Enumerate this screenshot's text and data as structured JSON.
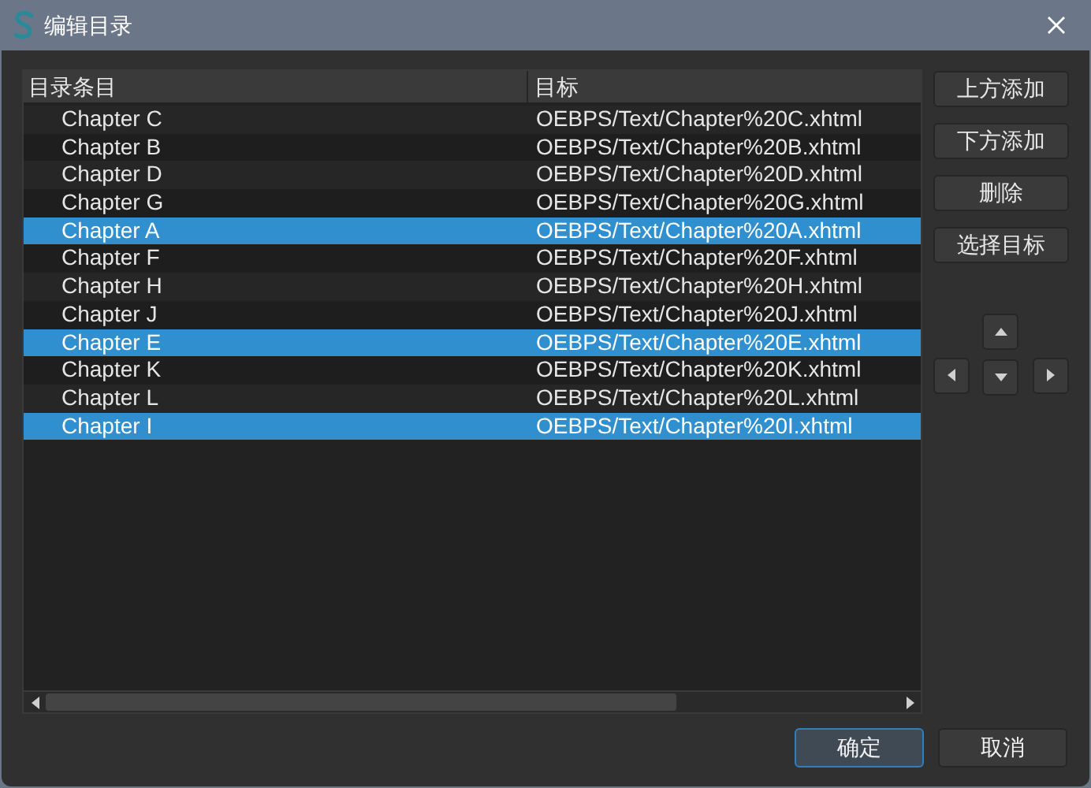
{
  "window": {
    "title": "编辑目录"
  },
  "table": {
    "columns": [
      "目录条目",
      "目标"
    ],
    "rows": [
      {
        "entry": "Chapter C",
        "target": "OEBPS/Text/Chapter%20C.xhtml",
        "selected": false
      },
      {
        "entry": "Chapter B",
        "target": "OEBPS/Text/Chapter%20B.xhtml",
        "selected": false
      },
      {
        "entry": "Chapter D",
        "target": "OEBPS/Text/Chapter%20D.xhtml",
        "selected": false
      },
      {
        "entry": "Chapter G",
        "target": "OEBPS/Text/Chapter%20G.xhtml",
        "selected": false
      },
      {
        "entry": "Chapter A",
        "target": "OEBPS/Text/Chapter%20A.xhtml",
        "selected": true
      },
      {
        "entry": "Chapter F",
        "target": "OEBPS/Text/Chapter%20F.xhtml",
        "selected": false
      },
      {
        "entry": "Chapter H",
        "target": "OEBPS/Text/Chapter%20H.xhtml",
        "selected": false
      },
      {
        "entry": "Chapter J",
        "target": "OEBPS/Text/Chapter%20J.xhtml",
        "selected": false
      },
      {
        "entry": "Chapter E",
        "target": "OEBPS/Text/Chapter%20E.xhtml",
        "selected": true
      },
      {
        "entry": "Chapter K",
        "target": "OEBPS/Text/Chapter%20K.xhtml",
        "selected": false
      },
      {
        "entry": "Chapter L",
        "target": "OEBPS/Text/Chapter%20L.xhtml",
        "selected": false
      },
      {
        "entry": "Chapter I",
        "target": "OEBPS/Text/Chapter%20I.xhtml",
        "selected": true
      }
    ]
  },
  "side_buttons": [
    "上方添加",
    "下方添加",
    "删除",
    "选择目标"
  ],
  "footer_buttons": [
    {
      "label": "确定",
      "kind": "default"
    },
    {
      "label": "取消",
      "kind": "normal"
    }
  ]
}
